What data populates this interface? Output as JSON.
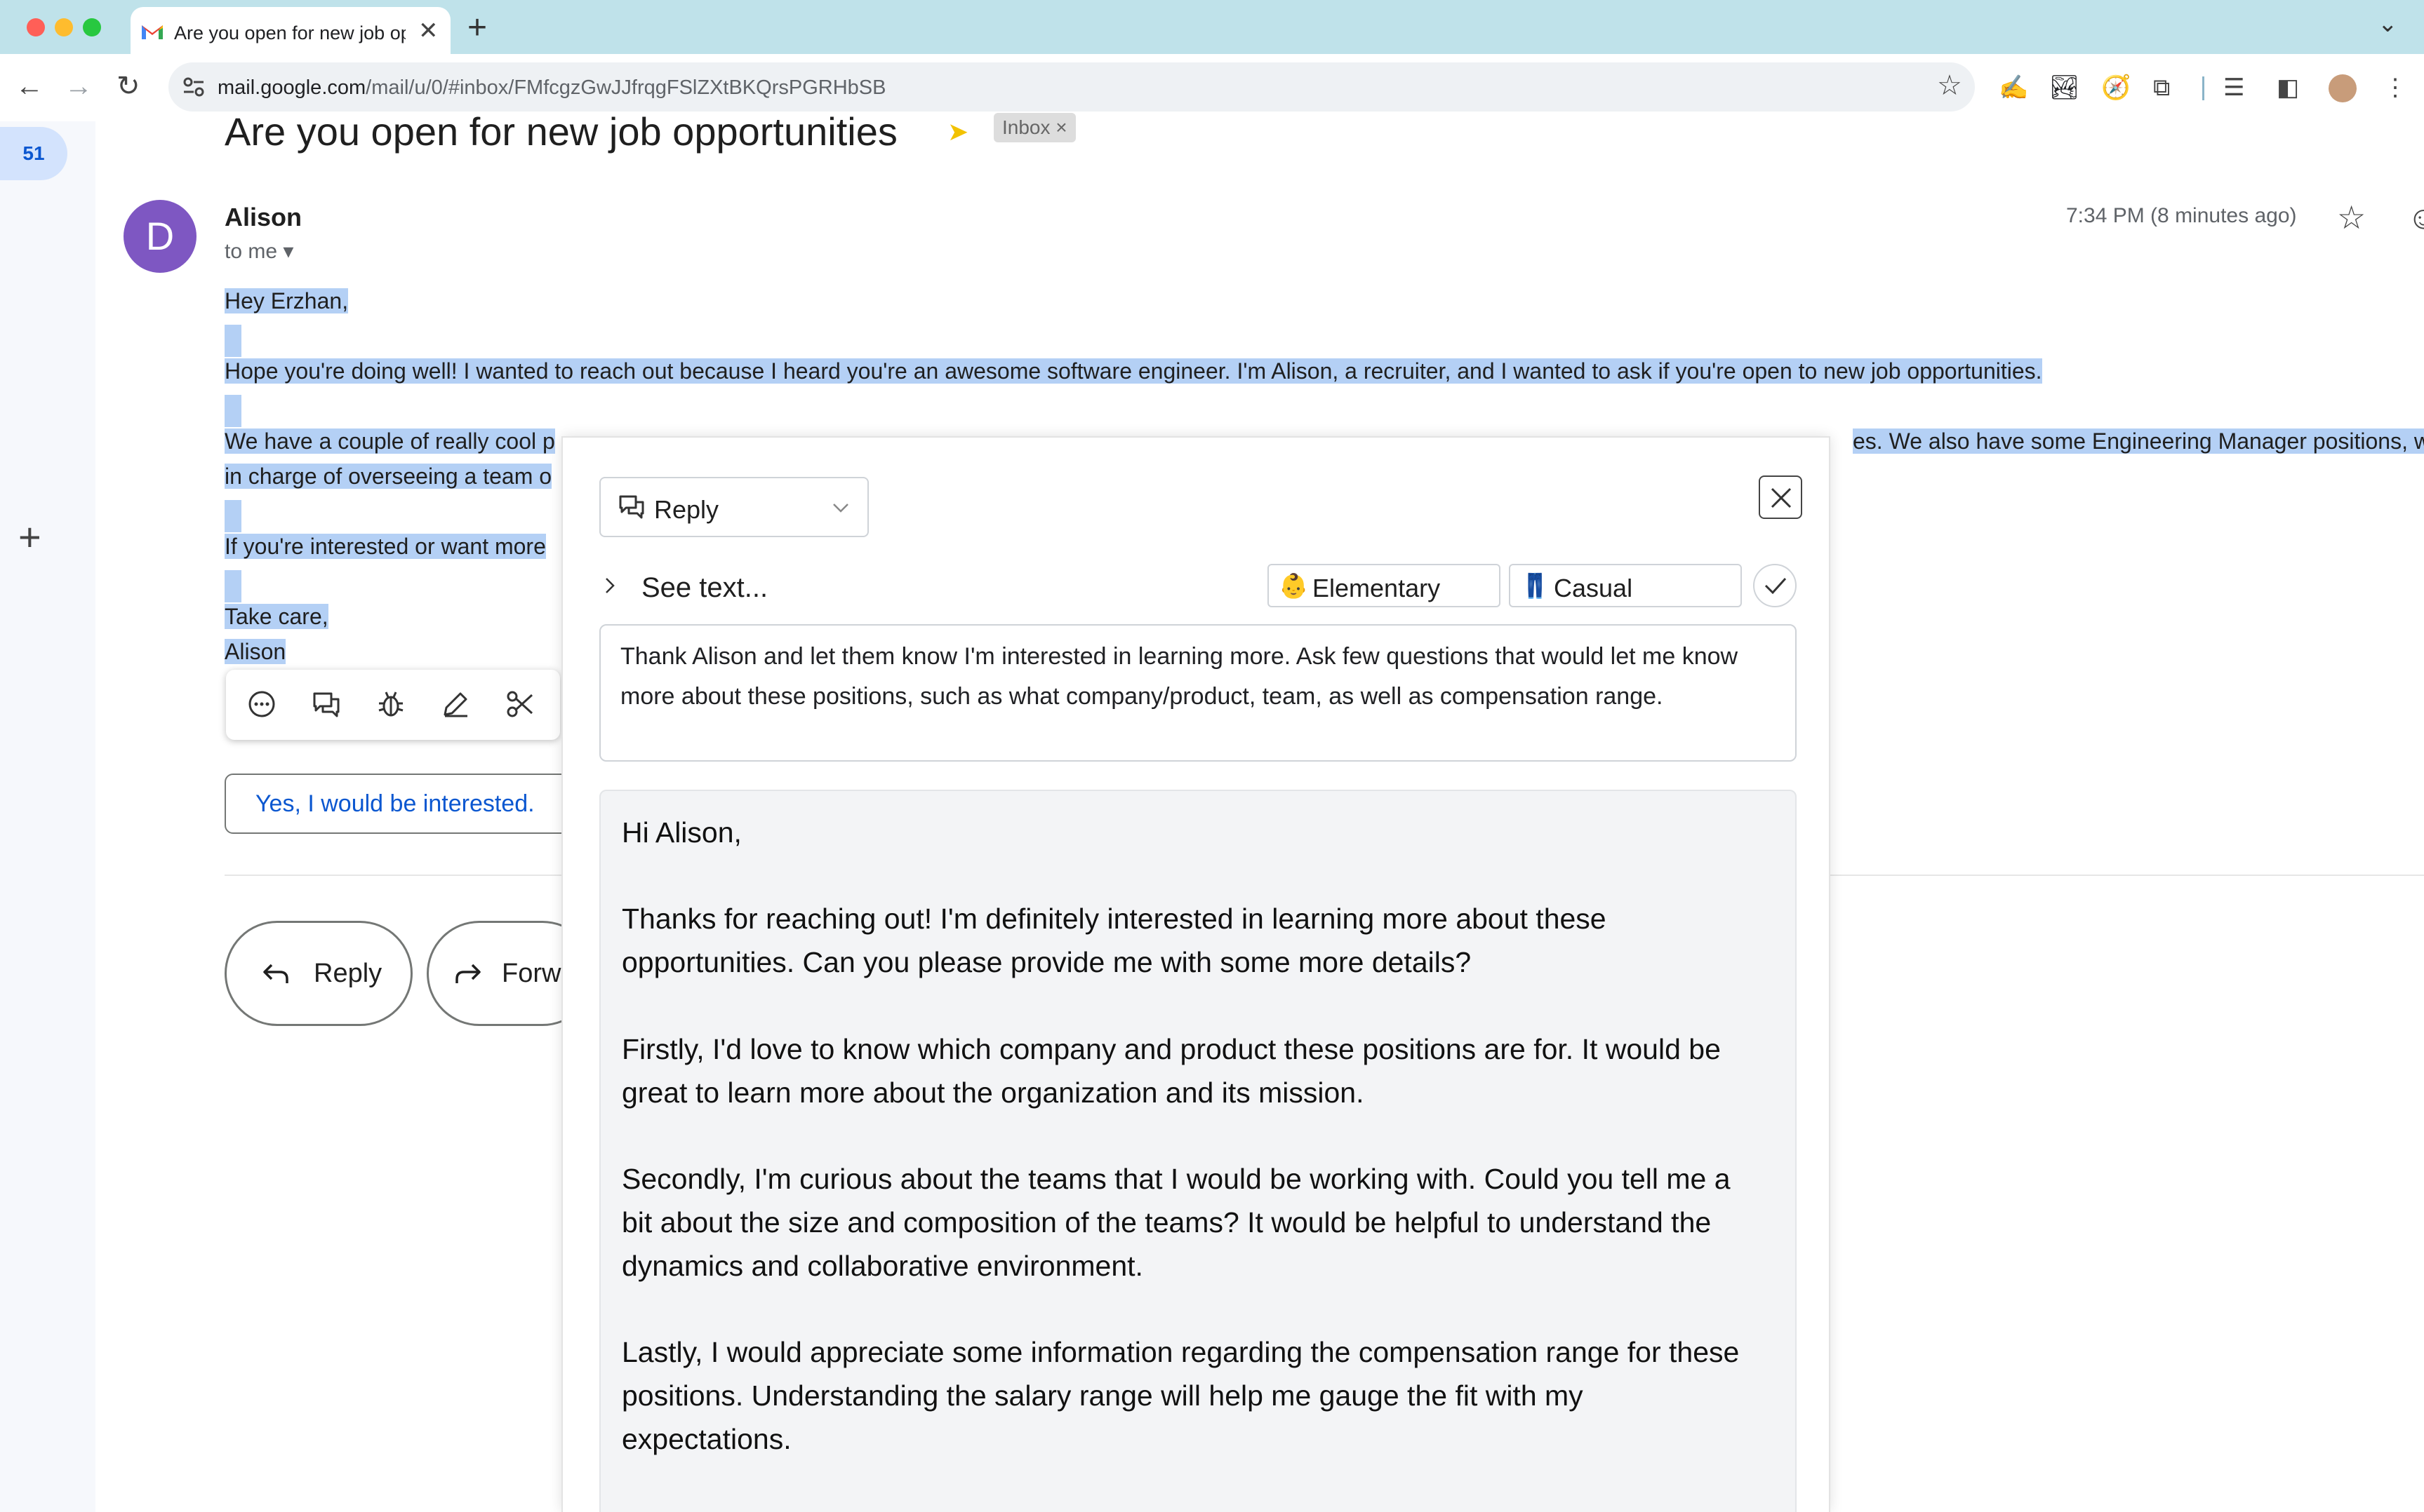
{
  "browser": {
    "tab_title": "Are you open for new job opp",
    "url_host": "mail.google.com",
    "url_path": "/mail/u/0/#inbox/FMfcgzGwJJfrqgFSlZXtBKQrsPGRHbSB"
  },
  "gmail": {
    "unread_count": "51",
    "subject": "Are you open for new job opportunities",
    "label": "Inbox ×",
    "sender_initial": "D",
    "sender_name": "Alison",
    "recipient": "to me ▾",
    "time": "7:34 PM (8 minutes ago)",
    "body": {
      "greeting": "Hey Erzhan,",
      "para1": "Hope you're doing well! I wanted to reach out because I heard you're an awesome software engineer. I'm Alison, a recruiter, and I wanted to ask if you're open to new job opportunities.",
      "para2_line1_start": "We have a couple of really cool p",
      "para2_line1_end": "es. We also have some Engineering Manager positions, w",
      "para2_line2": "in charge of overseeing a team o",
      "para3": "If you're interested or want more",
      "signoff": "Take care,",
      "signature": "Alison"
    },
    "smart_reply": "Yes, I would be interested.",
    "reply_button": "Reply",
    "forward_button": "Forw"
  },
  "assistant": {
    "mode": "Reply",
    "see_text": "See text...",
    "reading_level": {
      "emoji": "👶",
      "label": "Elementary"
    },
    "tone": {
      "emoji": "👖",
      "label": "Casual"
    },
    "instruction": "Thank Alison and let them know I'm interested in learning more. Ask few questions that would let me know more about these positions, such as what company/product, team, as well as compensation range.",
    "response_lines": [
      "Hi Alison,",
      "Thanks for reaching out! I'm definitely interested in learning more about these",
      "opportunities. Can you please provide me with some more details?",
      "Firstly, I'd love to know which company and product these positions are for. It would be",
      "great to learn more about the organization and its mission.",
      "Secondly, I'm curious about the teams that I would be working with. Could you tell me a",
      "bit about the size and composition of the teams? It would be helpful to understand the",
      "dynamics and collaborative environment.",
      "Lastly, I would appreciate some information regarding the compensation range for these",
      "positions. Understanding the salary range will help me gauge the fit with my",
      "expectations."
    ]
  },
  "colors": {
    "tabbar": "#bfe2ea",
    "selection_highlight": "#b4d0f5",
    "avatar": "#7e57c2",
    "link_blue": "#0b57d0"
  }
}
